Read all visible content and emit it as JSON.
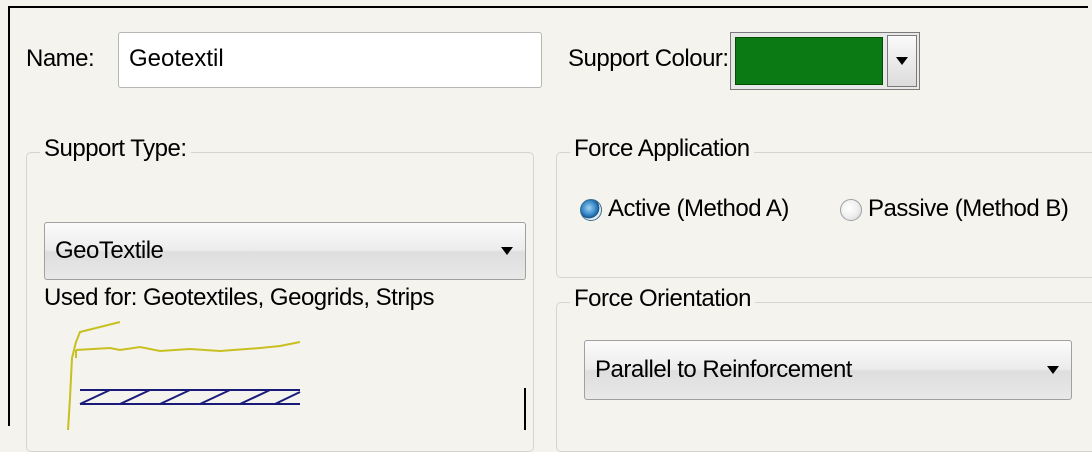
{
  "name": {
    "label": "Name:",
    "value": "Geotextil"
  },
  "support_colour": {
    "label": "Support Colour:",
    "color": "#0b7a14"
  },
  "support_type": {
    "legend": "Support Type:",
    "selected": "GeoTextile",
    "description": "Used for: Geotextiles, Geogrids, Strips",
    "preview_icon": "geotextile-preview-icon"
  },
  "force_application": {
    "legend": "Force Application",
    "options": [
      {
        "label": "Active (Method A)",
        "checked": true
      },
      {
        "label": "Passive (Method B)",
        "checked": false
      }
    ]
  },
  "force_orientation": {
    "legend": "Force Orientation",
    "selected": "Parallel to Reinforcement"
  }
}
